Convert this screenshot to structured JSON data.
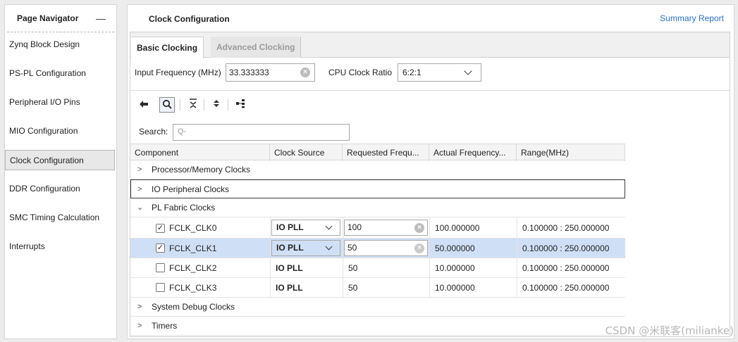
{
  "navigator": {
    "title": "Page Navigator",
    "minimize_label": "—",
    "items": [
      {
        "label": "Zynq Block Design"
      },
      {
        "label": "PS-PL Configuration"
      },
      {
        "label": "Peripheral I/O Pins"
      },
      {
        "label": "MIO Configuration"
      },
      {
        "label": "Clock Configuration",
        "active": true
      },
      {
        "label": "DDR Configuration"
      },
      {
        "label": "SMC Timing Calculation"
      },
      {
        "label": "Interrupts"
      }
    ]
  },
  "main": {
    "title": "Clock Configuration",
    "summary_link": "Summary Report",
    "tabs": [
      {
        "label": "Basic Clocking",
        "active": true
      },
      {
        "label": "Advanced Clocking",
        "active": false
      }
    ],
    "input_frequency": {
      "label": "Input Frequency (MHz)",
      "value": "33.333333"
    },
    "cpu_clock_ratio": {
      "label": "CPU Clock Ratio",
      "value": "6:2:1"
    },
    "search": {
      "label": "Search:",
      "placeholder": "Q-"
    },
    "table": {
      "headers": [
        "Component",
        "Clock Source",
        "Requested Frequ...",
        "Actual Frequency...",
        "Range(MHz)"
      ],
      "groups": [
        {
          "label": "Processor/Memory Clocks",
          "expanded": false
        },
        {
          "label": "IO Peripheral Clocks",
          "expanded": false
        },
        {
          "label": "PL Fabric Clocks",
          "expanded": true
        }
      ],
      "fclk_rows": [
        {
          "name": "FCLK_CLK0",
          "checked": true,
          "source": "IO PLL",
          "requested": "100",
          "actual": "100.000000",
          "range": "0.100000 : 250.000000"
        },
        {
          "name": "FCLK_CLK1",
          "checked": true,
          "source": "IO PLL",
          "requested": "50",
          "actual": "50.000000",
          "range": "0.100000 : 250.000000"
        },
        {
          "name": "FCLK_CLK2",
          "checked": false,
          "source": "IO PLL",
          "requested": "50",
          "actual": "10.000000",
          "range": "0.100000 : 250.000000"
        },
        {
          "name": "FCLK_CLK3",
          "checked": false,
          "source": "IO PLL",
          "requested": "50",
          "actual": "10.000000",
          "range": "0.100000 : 250.000000"
        }
      ],
      "trailing_groups": [
        {
          "label": "System Debug Clocks",
          "expanded": false
        },
        {
          "label": "Timers",
          "expanded": false
        }
      ]
    }
  },
  "icons": {
    "back": "back-arrow-icon",
    "search": "search-icon",
    "collapse_all": "collapse-all-icon",
    "expand_all": "expand-all-icon",
    "hierarchy": "hierarchy-icon"
  },
  "watermark": "CSDN @米联客(milianke)",
  "colors": {
    "selected_row": "#cfdff5",
    "link": "#2a6fc9"
  }
}
